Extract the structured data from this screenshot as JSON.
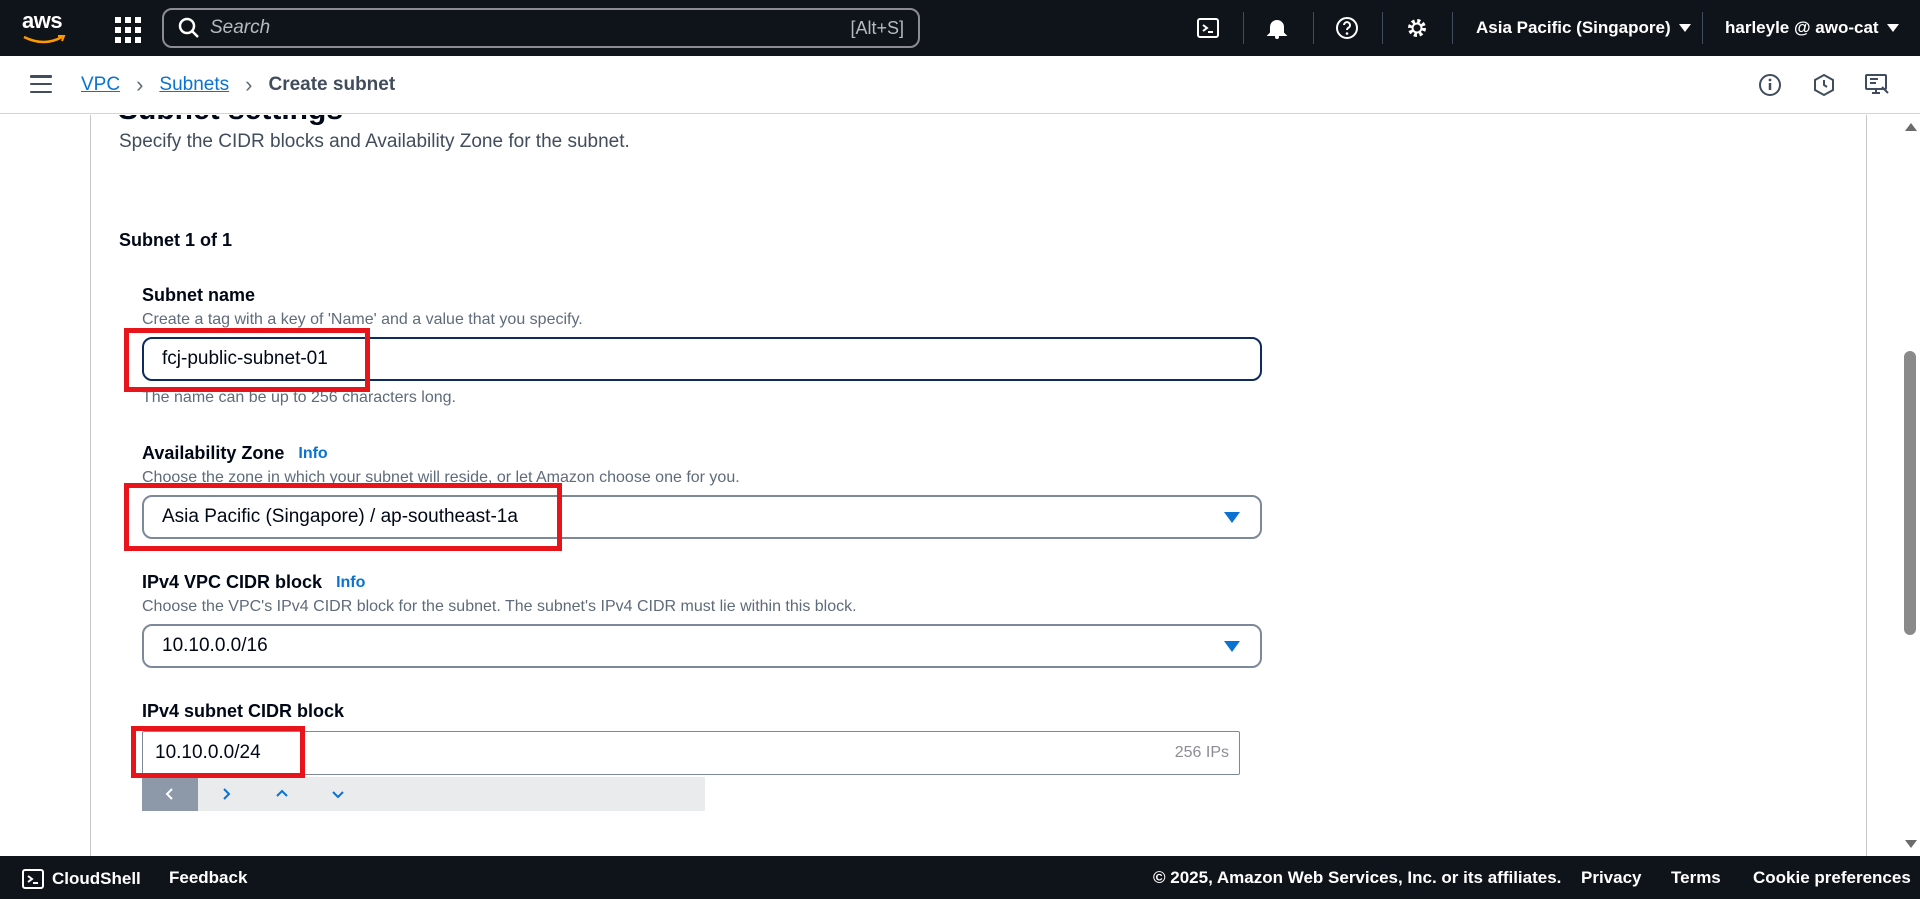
{
  "topnav": {
    "logo_text": "aws",
    "search_placeholder": "Search",
    "search_shortcut": "[Alt+S]",
    "region": "Asia Pacific (Singapore)",
    "user": "harleyle @ awo-cat"
  },
  "breadcrumb": {
    "items": [
      "VPC",
      "Subnets"
    ],
    "current": "Create subnet"
  },
  "section": {
    "title_partial": "Subnet settings",
    "description": "Specify the CIDR blocks and Availability Zone for the subnet."
  },
  "subnet": {
    "count_label": "Subnet 1 of 1",
    "name": {
      "label": "Subnet name",
      "description": "Create a tag with a key of 'Name' and a value that you specify.",
      "value": "fcj-public-subnet-01",
      "constraint": "The name can be up to 256 characters long."
    },
    "az": {
      "label": "Availability Zone",
      "info": "Info",
      "description": "Choose the zone in which your subnet will reside, or let Amazon choose one for you.",
      "value": "Asia Pacific (Singapore) / ap-southeast-1a"
    },
    "vpc_cidr": {
      "label": "IPv4 VPC CIDR block",
      "info": "Info",
      "description": "Choose the VPC's IPv4 CIDR block for the subnet. The subnet's IPv4 CIDR must lie within this block.",
      "value": "10.10.0.0/16"
    },
    "subnet_cidr": {
      "label": "IPv4 subnet CIDR block",
      "value": "10.10.0.0/24",
      "ip_count": "256 IPs"
    }
  },
  "footer": {
    "cloudshell": "CloudShell",
    "feedback": "Feedback",
    "copyright": "© 2025, Amazon Web Services, Inc. or its affiliates.",
    "privacy": "Privacy",
    "terms": "Terms",
    "cookie": "Cookie preferences"
  },
  "colors": {
    "nav_bg": "#0f141a",
    "link": "#0972d3",
    "highlight": "#e8141c"
  }
}
